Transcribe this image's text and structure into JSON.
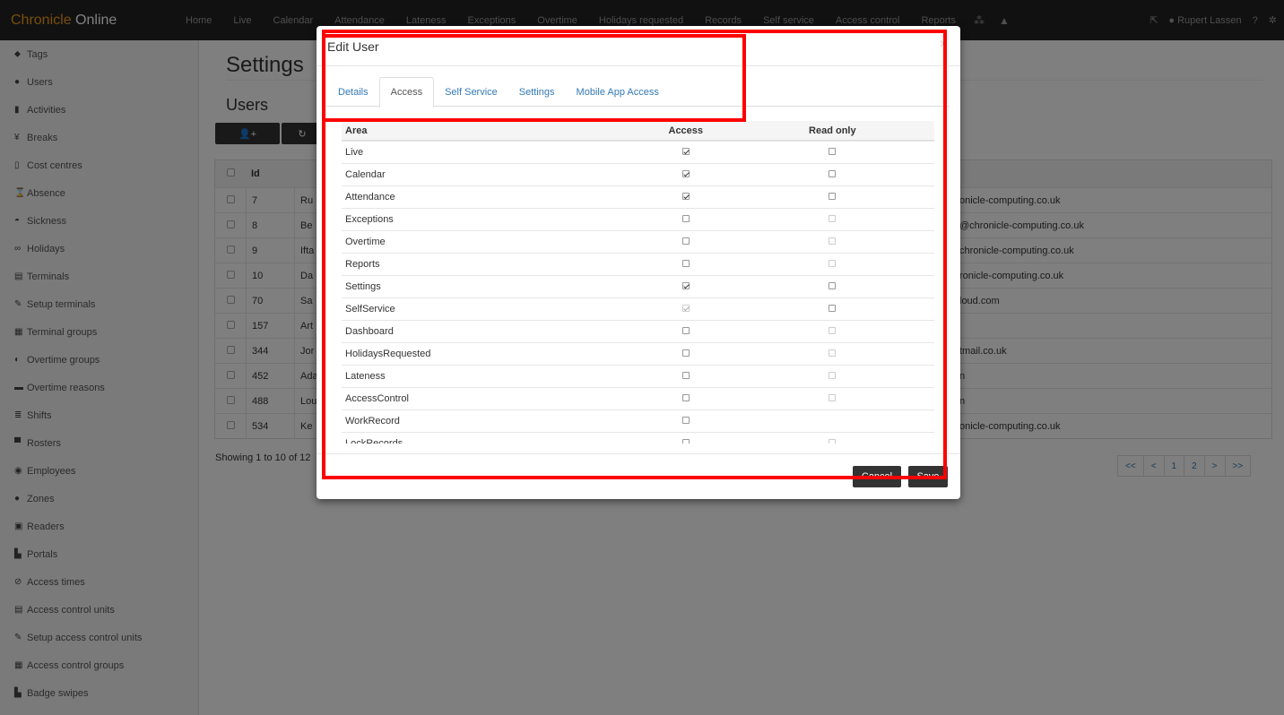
{
  "brand": {
    "part1": "Chronicle",
    "part2": " Online"
  },
  "nav": {
    "items": [
      "Home",
      "Live",
      "Calendar",
      "Attendance",
      "Lateness",
      "Exceptions",
      "Overtime",
      "Holidays requested",
      "Records",
      "Self service",
      "Access control",
      "Reports"
    ],
    "user": "Rupert Lassen"
  },
  "sidebar": {
    "items": [
      {
        "label": "Tags",
        "icon": "tags-icon",
        "glyph": "⬥"
      },
      {
        "label": "Users",
        "icon": "user-icon",
        "glyph": "●"
      },
      {
        "label": "Activities",
        "icon": "bars-icon",
        "glyph": "▮"
      },
      {
        "label": "Breaks",
        "icon": "cutlery-icon",
        "glyph": "¥"
      },
      {
        "label": "Cost centres",
        "icon": "signal-icon",
        "glyph": "▯"
      },
      {
        "label": "Absence",
        "icon": "hourglass-icon",
        "glyph": "⌛"
      },
      {
        "label": "Sickness",
        "icon": "sick-icon",
        "glyph": "◓"
      },
      {
        "label": "Holidays",
        "icon": "glasses-icon",
        "glyph": "∞"
      },
      {
        "label": "Terminals",
        "icon": "file-icon",
        "glyph": "▤"
      },
      {
        "label": "Setup terminals",
        "icon": "wrench-icon",
        "glyph": "✎"
      },
      {
        "label": "Terminal groups",
        "icon": "files-icon",
        "glyph": "▦"
      },
      {
        "label": "Overtime groups",
        "icon": "adjust-icon",
        "glyph": "◐"
      },
      {
        "label": "Overtime reasons",
        "icon": "comment-icon",
        "glyph": "▬"
      },
      {
        "label": "Shifts",
        "icon": "list-icon",
        "glyph": "≣"
      },
      {
        "label": "Rosters",
        "icon": "tasks-icon",
        "glyph": "▀"
      },
      {
        "label": "Employees",
        "icon": "eye-icon",
        "glyph": "◉"
      },
      {
        "label": "Zones",
        "icon": "circle-icon",
        "glyph": "●"
      },
      {
        "label": "Readers",
        "icon": "reader-icon",
        "glyph": "▣"
      },
      {
        "label": "Portals",
        "icon": "portal-icon",
        "glyph": "▙"
      },
      {
        "label": "Access times",
        "icon": "ban-icon",
        "glyph": "⊘"
      },
      {
        "label": "Access control units",
        "icon": "file-icon",
        "glyph": "▤"
      },
      {
        "label": "Setup access control units",
        "icon": "wrench-icon",
        "glyph": "✎"
      },
      {
        "label": "Access control groups",
        "icon": "files-icon",
        "glyph": "▦"
      },
      {
        "label": "Badge swipes",
        "icon": "portal-icon",
        "glyph": "▙"
      }
    ]
  },
  "main": {
    "page_title": "Settings",
    "section_title": "Users",
    "add_button": "👤+",
    "refresh_button": "↻",
    "grid": {
      "header_id": "Id",
      "rows": [
        {
          "id": "7",
          "name": "Ru",
          "email": "onicle-computing.co.uk"
        },
        {
          "id": "8",
          "name": "Be",
          "email": "@chronicle-computing.co.uk"
        },
        {
          "id": "9",
          "name": "Ifta",
          "email": "chronicle-computing.co.uk"
        },
        {
          "id": "10",
          "name": "Da",
          "email": "ronicle-computing.co.uk"
        },
        {
          "id": "70",
          "name": "Sa",
          "email": "loud.com"
        },
        {
          "id": "157",
          "name": "Art",
          "email": ""
        },
        {
          "id": "344",
          "name": "Jor",
          "email": "tmail.co.uk"
        },
        {
          "id": "452",
          "name": "Ada",
          "email": "n"
        },
        {
          "id": "488",
          "name": "Lou",
          "email": "n"
        },
        {
          "id": "534",
          "name": "Ke",
          "email": "onicle-computing.co.uk"
        }
      ]
    },
    "showing": "Showing 1 to 10 of 12",
    "pager": [
      "<<",
      "<",
      "1",
      "2",
      ">",
      ">>"
    ]
  },
  "modal": {
    "title": "Edit User",
    "close": "×",
    "tabs": [
      {
        "label": "Details",
        "active": false
      },
      {
        "label": "Access",
        "active": true
      },
      {
        "label": "Self Service",
        "active": false
      },
      {
        "label": "Settings",
        "active": false
      },
      {
        "label": "Mobile App Access",
        "active": false
      }
    ],
    "table": {
      "col_area": "Area",
      "col_access": "Access",
      "col_readonly": "Read only",
      "rows": [
        {
          "area": "Live",
          "access": true,
          "access_dim": false,
          "ro": false,
          "ro_dim": false,
          "ro_show": true
        },
        {
          "area": "Calendar",
          "access": true,
          "access_dim": false,
          "ro": false,
          "ro_dim": false,
          "ro_show": true
        },
        {
          "area": "Attendance",
          "access": true,
          "access_dim": false,
          "ro": false,
          "ro_dim": false,
          "ro_show": true
        },
        {
          "area": "Exceptions",
          "access": false,
          "access_dim": false,
          "ro": false,
          "ro_dim": true,
          "ro_show": true
        },
        {
          "area": "Overtime",
          "access": false,
          "access_dim": false,
          "ro": false,
          "ro_dim": true,
          "ro_show": true
        },
        {
          "area": "Reports",
          "access": false,
          "access_dim": false,
          "ro": false,
          "ro_dim": true,
          "ro_show": true
        },
        {
          "area": "Settings",
          "access": true,
          "access_dim": false,
          "ro": false,
          "ro_dim": false,
          "ro_show": true
        },
        {
          "area": "SelfService",
          "access": true,
          "access_dim": true,
          "ro": false,
          "ro_dim": false,
          "ro_show": true
        },
        {
          "area": "Dashboard",
          "access": false,
          "access_dim": false,
          "ro": false,
          "ro_dim": true,
          "ro_show": true
        },
        {
          "area": "HolidaysRequested",
          "access": false,
          "access_dim": false,
          "ro": false,
          "ro_dim": true,
          "ro_show": true
        },
        {
          "area": "Lateness",
          "access": false,
          "access_dim": false,
          "ro": false,
          "ro_dim": true,
          "ro_show": true
        },
        {
          "area": "AccessControl",
          "access": false,
          "access_dim": false,
          "ro": false,
          "ro_dim": true,
          "ro_show": true
        },
        {
          "area": "WorkRecord",
          "access": false,
          "access_dim": false,
          "ro": false,
          "ro_dim": false,
          "ro_show": false
        },
        {
          "area": "LockRecords",
          "access": false,
          "access_dim": false,
          "ro": false,
          "ro_dim": true,
          "ro_show": true
        }
      ]
    },
    "cancel": "Cancel",
    "save": "Save"
  },
  "annotation_color": "#ff0000"
}
